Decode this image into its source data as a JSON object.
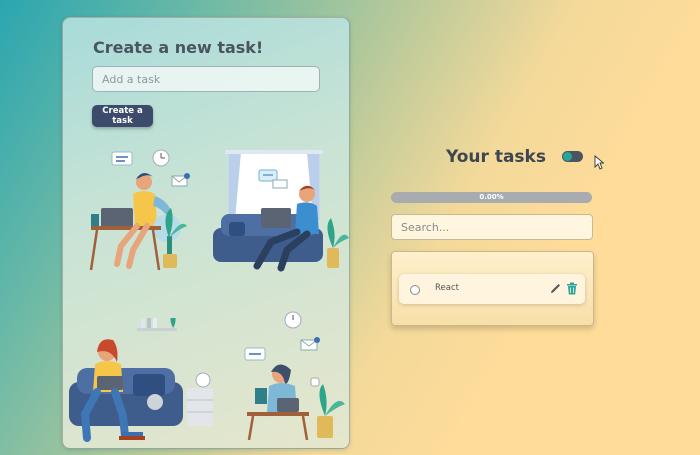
{
  "create_card": {
    "title": "Create a new task!",
    "input_placeholder": "Add a task",
    "button_label": "Create a task"
  },
  "tasks_section": {
    "title": "Your tasks",
    "theme_toggle_on": true,
    "progress": {
      "value_percent": 0,
      "label": "0.00%"
    },
    "search_placeholder": "Search...",
    "tasks": [
      {
        "label": "React",
        "completed": false
      }
    ]
  },
  "icons": [
    "edit-icon",
    "delete-icon",
    "theme-toggle",
    "cursor-icon"
  ],
  "colors": {
    "accent": "#2ba59a",
    "button": "#3c4a6b",
    "delete": "#2ba59a"
  }
}
